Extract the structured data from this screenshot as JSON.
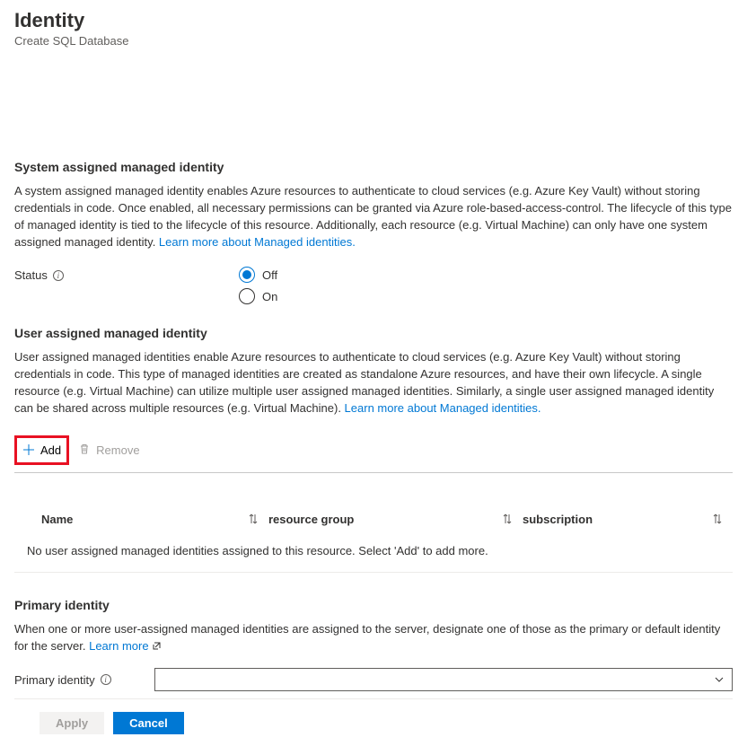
{
  "header": {
    "title": "Identity",
    "subtitle": "Create SQL Database"
  },
  "system": {
    "heading": "System assigned managed identity",
    "desc": "A system assigned managed identity enables Azure resources to authenticate to cloud services (e.g. Azure Key Vault) without storing credentials in code. Once enabled, all necessary permissions can be granted via Azure role-based-access-control. The lifecycle of this type of managed identity is tied to the lifecycle of this resource. Additionally, each resource (e.g. Virtual Machine) can only have one system assigned managed identity. ",
    "learn": "Learn more about Managed identities.",
    "status_label": "Status",
    "off": "Off",
    "on": "On"
  },
  "user": {
    "heading": "User assigned managed identity",
    "desc": "User assigned managed identities enable Azure resources to authenticate to cloud services (e.g. Azure Key Vault) without storing credentials in code. This type of managed identities are created as standalone Azure resources, and have their own lifecycle. A single resource (e.g. Virtual Machine) can utilize multiple user assigned managed identities. Similarly, a single user assigned managed identity can be shared across multiple resources (e.g. Virtual Machine). ",
    "learn": "Learn more about Managed identities.",
    "add": "Add",
    "remove": "Remove"
  },
  "table": {
    "cols": {
      "name": "Name",
      "rg": "resource group",
      "sub": "subscription"
    },
    "empty": "No user assigned managed identities assigned to this resource. Select 'Add' to add more."
  },
  "primary": {
    "heading": "Primary identity",
    "desc": "When one or more user-assigned managed identities are assigned to the server, designate one of those as the primary or default identity for the server. ",
    "learn": "Learn more",
    "label": "Primary identity"
  },
  "footer": {
    "apply": "Apply",
    "cancel": "Cancel"
  },
  "colors": {
    "accent": "#0078d4",
    "highlight": "#e81123"
  }
}
